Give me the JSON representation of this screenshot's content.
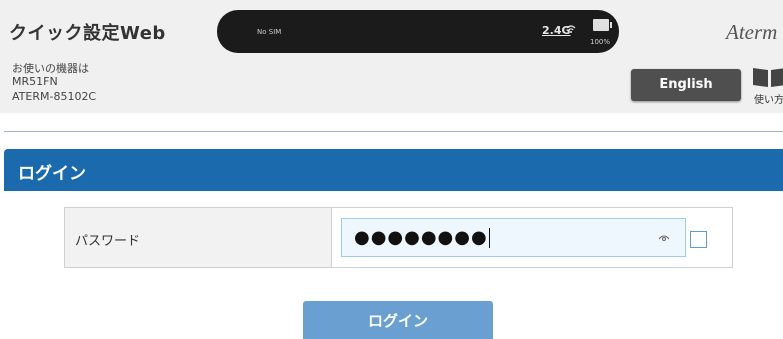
{
  "header": {
    "title": "クイック設定Web",
    "brand": "Aterm",
    "device": {
      "label": "お使いの機器は",
      "model": "MR51FN",
      "id": "ATERM-85102C"
    },
    "status": {
      "sim": "No SIM",
      "band": "2.4G",
      "battery": "100%",
      "wifi_icon": "wifi-signal-icon",
      "battery_icon": "battery-icon"
    },
    "language_button": "English",
    "manual_label": "使い方"
  },
  "login_section": {
    "title": "ログイン",
    "password_label": "パスワード",
    "password_value": "●●●●●●●●",
    "show_password_icon": "eye-icon",
    "submit_label": "ログイン"
  },
  "colors": {
    "section_bar": "#1b6aae",
    "login_button": "#6aa0d1",
    "header_bg": "#f0f0f0",
    "lang_button": "#4f4f4f"
  }
}
